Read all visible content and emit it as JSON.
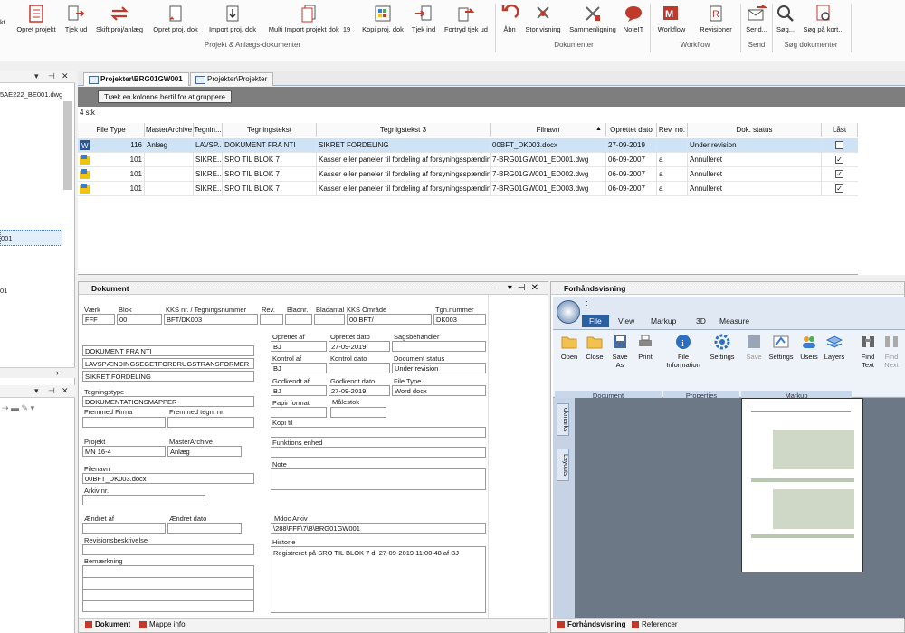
{
  "ribbon": {
    "left_cut_label": "kt",
    "buttons": [
      {
        "label": "Opret projekt",
        "icon": "document-red-icon"
      },
      {
        "label": "Tjek ud",
        "icon": "checkout-icon"
      },
      {
        "label": "Skift proj/anlæg",
        "icon": "switch-arrows-icon"
      },
      {
        "label": "Opret proj. dok",
        "icon": "new-document-star-icon"
      },
      {
        "label": "Import proj. dok",
        "icon": "import-icon"
      },
      {
        "label": "Multi Import projekt dok_19",
        "icon": "multi-import-icon"
      },
      {
        "label": "Kopi proj. dok",
        "icon": "copy-icon"
      },
      {
        "label": "Tjek ind",
        "icon": "checkin-icon"
      },
      {
        "label": "Fortryd tjek ud",
        "icon": "undo-checkout-icon"
      },
      {
        "label": "Åbn",
        "icon": "open-arrow-icon"
      },
      {
        "label": "Stor visning",
        "icon": "large-view-icon"
      },
      {
        "label": "Sammenligning",
        "icon": "compare-icon"
      },
      {
        "label": "NoteIT",
        "icon": "note-bubble-icon"
      },
      {
        "label": "Workflow",
        "icon": "workflow-icon"
      },
      {
        "label": "Revisioner",
        "icon": "revisions-icon"
      },
      {
        "label": "Send...",
        "icon": "send-mail-icon"
      },
      {
        "label": "Søg...",
        "icon": "search-icon"
      },
      {
        "label": "Søg på kort...",
        "icon": "search-card-icon"
      }
    ],
    "groups": [
      "Projekt & Anlægs-dokumenter",
      "Dokumenter",
      "Workflow",
      "Send",
      "Søg dokumenter"
    ]
  },
  "left": {
    "top_item": "5AE222_BE001.dwg",
    "selected_item": "001",
    "item2": "01"
  },
  "tabs": [
    {
      "label": "Projekter\\BRG01GW001"
    },
    {
      "label": "Projekter\\Projekter"
    }
  ],
  "groupbar_hint": "Træk en kolonne hertil for at gruppere",
  "grid": {
    "count": "4 stk",
    "columns": [
      "File Type",
      "MasterArchive",
      "Tegnin...",
      "Tegningstekst",
      "Tegnigstekst 3",
      "Filnavn",
      "Oprettet dato",
      "Rev. no.",
      "Dok. status",
      "Låst"
    ],
    "rows": [
      {
        "type": "116",
        "master": "Anlæg",
        "tegn": "LAVSP...",
        "tekst": "DOKUMENT FRA NTI",
        "tekst3": "SIKRET FORDELING",
        "fil": "00BFT_DK003.docx",
        "dato": "27-09-2019",
        "rev": "",
        "status": "Under revision",
        "laast": false
      },
      {
        "type": "101",
        "master": "",
        "tegn": "SIKRE...",
        "tekst": "SRO TIL BLOK 7",
        "tekst3": "Kasser eller paneler til fordeling af forsyningsspænding.",
        "fil": "7-BRG01GW001_ED001.dwg",
        "dato": "06-09-2007",
        "rev": "a",
        "status": "Annulleret",
        "laast": true
      },
      {
        "type": "101",
        "master": "",
        "tegn": "SIKRE...",
        "tekst": "SRO TIL BLOK 7",
        "tekst3": "Kasser eller paneler til fordeling af forsyningsspænding.",
        "fil": "7-BRG01GW001_ED002.dwg",
        "dato": "06-09-2007",
        "rev": "a",
        "status": "Annulleret",
        "laast": true
      },
      {
        "type": "101",
        "master": "",
        "tegn": "SIKRE...",
        "tekst": "SRO TIL BLOK 7",
        "tekst3": "Kasser eller paneler til fordeling af forsyningsspænding.",
        "fil": "7-BRG01GW001_ED003.dwg",
        "dato": "06-09-2007",
        "rev": "a",
        "status": "Annulleret",
        "laast": true
      }
    ]
  },
  "doc": {
    "title": "Dokument",
    "labels": {
      "vaerk": "Værk",
      "blok": "Blok",
      "kks": "KKS nr. / Tegningsnummer",
      "rev": "Rev.",
      "bladnr": "Bladnr.",
      "bladantal": "Bladantal",
      "kksomr": "KKS Område",
      "tgn": "Tgn.nummer",
      "oprettet_af": "Oprettet af",
      "oprettet_dato": "Oprettet dato",
      "sagsbeh": "Sagsbehandler",
      "kontrol_af": "Kontrol af",
      "kontrol_dato": "Kontrol dato",
      "doc_status": "Document status",
      "godkendt_af": "Godkendt af",
      "godkendt_dato": "Godkendt dato",
      "file_type": "File Type",
      "papir": "Papir format",
      "maalestok": "Målestok",
      "tegningstype": "Tegningstype",
      "fremmed_firma": "Fremmed Firma",
      "fremmed_tegn": "Fremmed tegn. nr.",
      "kopi_til": "Kopi til",
      "funktions": "Funktions enhed",
      "projekt": "Projekt",
      "masterarchive": "MasterArchive",
      "note": "Note",
      "filenavn": "Filenavn",
      "arkiv": "Arkiv nr.",
      "aendret_af": "Ændret af",
      "aendret_dato": "Ændret dato",
      "mdoc": "Mdoc Arkiv",
      "revbeskr": "Revisionsbeskrivelse",
      "historie": "Historie",
      "bemaerkning": "Bemærkning"
    },
    "values": {
      "vaerk": "FFF",
      "blok": "00",
      "kks": "BFT/DK003",
      "kksomr": "00 BFT/",
      "tgn": "DK003",
      "tekst1": "DOKUMENT FRA NTI",
      "tekst2": "LAVSPÆNDINGSEGETFORBRUGSTRANSFORMER",
      "tekst3": "SIKRET FORDELING",
      "oprettet_af": "BJ",
      "oprettet_dato": "27-09-2019",
      "kontrol_af": "BJ",
      "doc_status": "Under revision",
      "godkendt_af": "BJ",
      "godkendt_dato": "27-09-2019",
      "file_type": "Word docx",
      "tegningstype": "DOKUMENTATIONSMAPPER",
      "projekt": "MN 16-4",
      "masterarchive": "Anlæg",
      "filenavn": "00BFT_DK003.docx",
      "mdoc": "\\288\\FFF\\7\\B\\BRG01GW001",
      "historie": "Registreret på SRO TIL BLOK 7 d. 27-09-2019 11:00:48 af BJ"
    },
    "bottom_tabs": [
      "Dokument",
      "Mappe info"
    ]
  },
  "preview": {
    "title": "Forhåndsvisning",
    "tabs": [
      "File",
      "View",
      "Markup",
      "3D",
      "Measure"
    ],
    "buttons": [
      "Open",
      "Close",
      "Save As",
      "Print",
      "File Information",
      "Settings",
      "Save",
      "Settings",
      "Users",
      "Layers",
      "Find Text",
      "Find Next"
    ],
    "groups": [
      "Document",
      "Properties",
      "Markup"
    ],
    "side_tabs": [
      "okmarks",
      "Layouts"
    ],
    "bottom_tabs": [
      "Forhåndsvisning",
      "Referencer"
    ]
  }
}
